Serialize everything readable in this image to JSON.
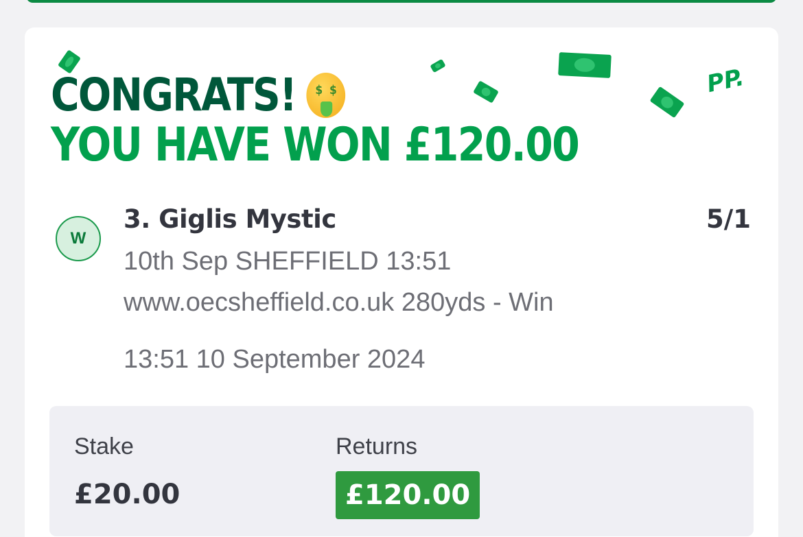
{
  "banner": {
    "line1": "CONGRATS!",
    "line2": "YOU HAVE WON £120.00",
    "emoji_icon": "money-mouth-face-icon",
    "brand_mark": "PP."
  },
  "bet": {
    "result_badge": "W",
    "selection": "3. Giglis Mystic",
    "odds": "5/1",
    "event": "10th Sep SHEFFIELD 13:51",
    "race_details": "www.oecsheffield.co.uk 280yds - Win",
    "placed_at": "13:51 10 September 2024"
  },
  "summary": {
    "stake_label": "Stake",
    "stake_value": "£20.00",
    "returns_label": "Returns",
    "returns_value": "£120.00"
  },
  "colors": {
    "dark_green": "#00573a",
    "bright_green": "#02a04d",
    "returns_green": "#2f9a3f"
  }
}
